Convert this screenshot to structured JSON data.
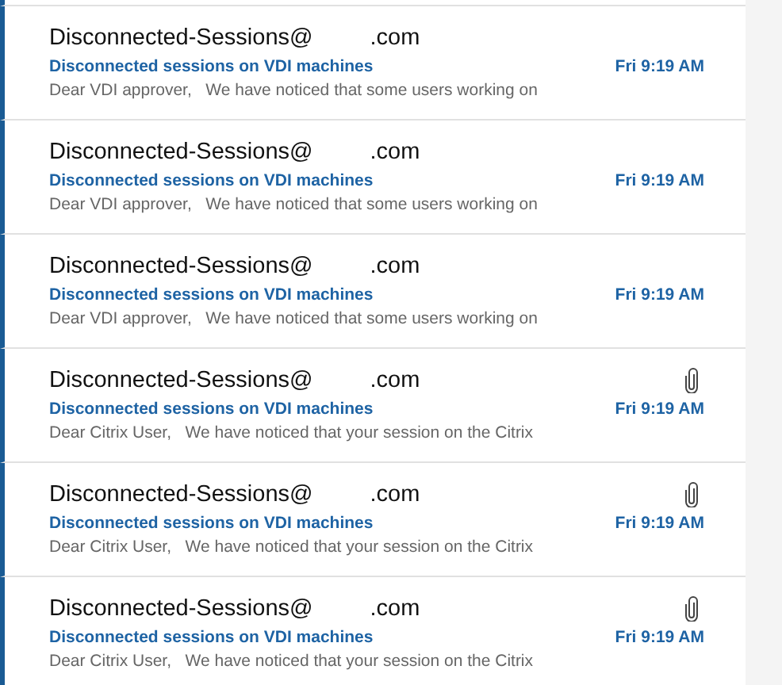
{
  "messages": [
    {
      "sender": "Disconnected-Sessions@",
      "sender_domain": ".com",
      "subject": "Disconnected sessions on VDI machines",
      "time": "Fri 9:19 AM",
      "preview": "Dear VDI approver,   We have noticed that some users working on",
      "unread": true,
      "has_attachment": false
    },
    {
      "sender": "Disconnected-Sessions@",
      "sender_domain": ".com",
      "subject": "Disconnected sessions on VDI machines",
      "time": "Fri 9:19 AM",
      "preview": "Dear VDI approver,   We have noticed that some users working on",
      "unread": true,
      "has_attachment": false
    },
    {
      "sender": "Disconnected-Sessions@",
      "sender_domain": ".com",
      "subject": "Disconnected sessions on VDI machines",
      "time": "Fri 9:19 AM",
      "preview": "Dear VDI approver,   We have noticed that some users working on",
      "unread": true,
      "has_attachment": false
    },
    {
      "sender": "Disconnected-Sessions@",
      "sender_domain": ".com",
      "subject": "Disconnected sessions on VDI machines",
      "time": "Fri 9:19 AM",
      "preview": "Dear Citrix User,   We have noticed that your session on the Citrix",
      "unread": true,
      "has_attachment": true
    },
    {
      "sender": "Disconnected-Sessions@",
      "sender_domain": ".com",
      "subject": "Disconnected sessions on VDI machines",
      "time": "Fri 9:19 AM",
      "preview": "Dear Citrix User,   We have noticed that your session on the Citrix",
      "unread": true,
      "has_attachment": true
    },
    {
      "sender": "Disconnected-Sessions@",
      "sender_domain": ".com",
      "subject": "Disconnected sessions on VDI machines",
      "time": "Fri 9:19 AM",
      "preview": "Dear Citrix User,   We have noticed that your session on the Citrix",
      "unread": true,
      "has_attachment": true
    }
  ]
}
